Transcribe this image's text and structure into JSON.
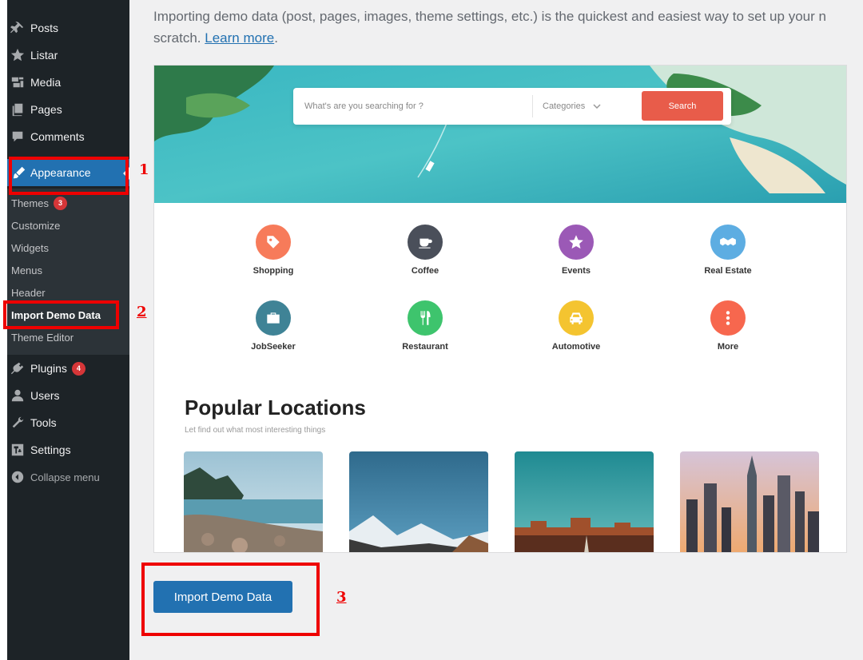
{
  "sidebar": {
    "items": [
      {
        "label": "Posts",
        "icon": "pin-icon"
      },
      {
        "label": "Listar",
        "icon": "star-icon"
      },
      {
        "label": "Media",
        "icon": "media-icon"
      },
      {
        "label": "Pages",
        "icon": "pages-icon"
      },
      {
        "label": "Comments",
        "icon": "comment-icon"
      }
    ],
    "appearance_label": "Appearance",
    "submenu": [
      {
        "label": "Themes",
        "badge": "3"
      },
      {
        "label": "Customize"
      },
      {
        "label": "Widgets"
      },
      {
        "label": "Menus"
      },
      {
        "label": "Header"
      },
      {
        "label": "Import Demo Data",
        "current": true
      },
      {
        "label": "Theme Editor"
      }
    ],
    "items_bottom": [
      {
        "label": "Plugins",
        "icon": "plugin-icon",
        "badge": "4"
      },
      {
        "label": "Users",
        "icon": "user-icon"
      },
      {
        "label": "Tools",
        "icon": "wrench-icon"
      },
      {
        "label": "Settings",
        "icon": "settings-icon"
      }
    ],
    "collapse_label": "Collapse menu"
  },
  "annotations": {
    "step1": "1",
    "step2": "2",
    "step3": "3"
  },
  "intro": {
    "text": "Importing demo data (post, pages, images, theme settings, etc.) is the quickest and easiest way to set up your n",
    "text_line2": "scratch. ",
    "link": "Learn more",
    "after_link": "."
  },
  "preview": {
    "search_placeholder": "What's are you searching for ?",
    "categories_label": "Categories",
    "search_button": "Search",
    "categories": [
      {
        "label": "Shopping",
        "color": "#f77b5a",
        "icon": "tag-icon"
      },
      {
        "label": "Coffee",
        "color": "#4a4f5a",
        "icon": "coffee-icon"
      },
      {
        "label": "Events",
        "color": "#9b59b6",
        "icon": "star-icon"
      },
      {
        "label": "Real Estate",
        "color": "#5dade2",
        "icon": "handshake-icon"
      },
      {
        "label": "JobSeeker",
        "color": "#3f8396",
        "icon": "briefcase-icon"
      },
      {
        "label": "Restaurant",
        "color": "#3ec46d",
        "icon": "fork-knife-icon"
      },
      {
        "label": "Automotive",
        "color": "#f4c430",
        "icon": "car-icon"
      },
      {
        "label": "More",
        "color": "#f7674e",
        "icon": "more-icon"
      }
    ],
    "popular_title": "Popular Locations",
    "popular_subtitle": "Let find out what most interesting things"
  },
  "import_button": "Import Demo Data",
  "colors": {
    "sidebar_bg": "#1d2327",
    "submenu_bg": "#2c3338",
    "accent": "#2271b1",
    "annotation_red": "#e00000",
    "badge": "#d63638"
  }
}
